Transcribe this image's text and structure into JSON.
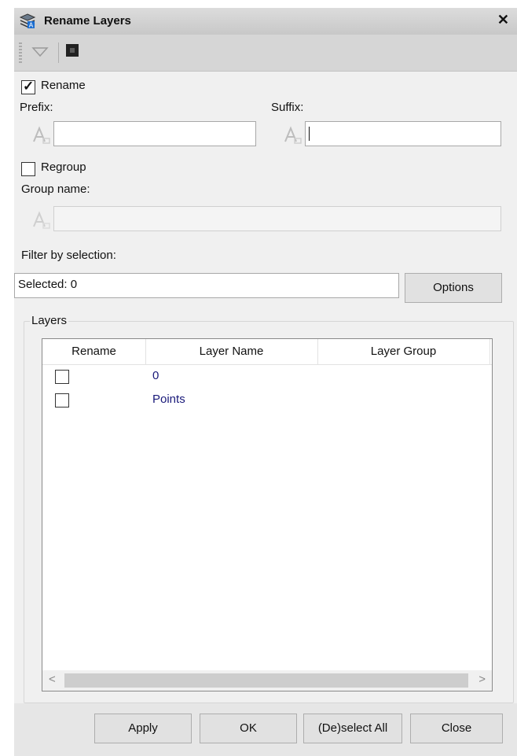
{
  "window": {
    "title": "Rename Layers",
    "close_glyph": "✕"
  },
  "toolbar": {
    "items": [
      "dropdown-arrow-icon",
      "command-window-icon"
    ]
  },
  "rename": {
    "label": "Rename",
    "checked": true
  },
  "prefix": {
    "label": "Prefix:",
    "value": ""
  },
  "suffix": {
    "label": "Suffix:",
    "value": ""
  },
  "regroup": {
    "label": "Regroup",
    "checked": false
  },
  "group_name": {
    "label": "Group name:",
    "value": ""
  },
  "filter": {
    "label": "Filter by selection:",
    "value": "Selected: 0",
    "options_label": "Options"
  },
  "layers": {
    "title": "Layers",
    "columns": [
      "Rename",
      "Layer Name",
      "Layer Group"
    ],
    "rows": [
      {
        "rename": false,
        "name": "0",
        "group": ""
      },
      {
        "rename": false,
        "name": "Points",
        "group": ""
      }
    ],
    "scroll_left": "<",
    "scroll_right": ">"
  },
  "footer": {
    "apply": "Apply",
    "ok": "OK",
    "deselect_all": "(De)select All",
    "close": "Close"
  },
  "colors": {
    "accent": "#1a1a7a",
    "panel_bg": "#f0f0f0",
    "button_bg": "#e1e1e1"
  }
}
